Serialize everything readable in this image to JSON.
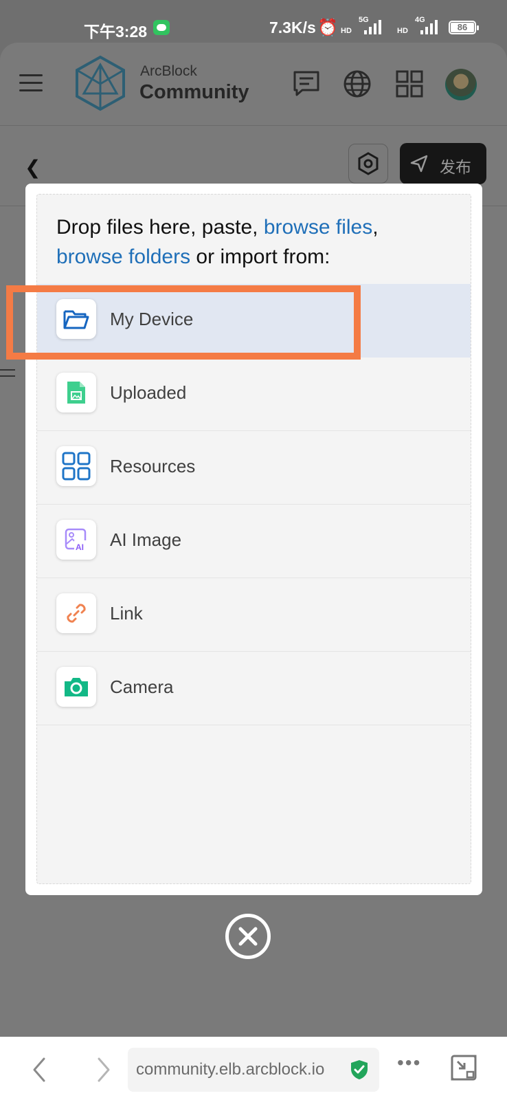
{
  "status_bar": {
    "time": "下午3:28",
    "net_speed": "7.3K/s",
    "sim1_label": "5G",
    "sim2_label": "4G",
    "hd_label": "HD",
    "battery": "86"
  },
  "header": {
    "brand_small": "ArcBlock",
    "brand_big": "Community"
  },
  "editor_bar": {
    "publish_label": "发布"
  },
  "upload_modal": {
    "prompt_text_1": "Drop files here, paste, ",
    "browse_files": "browse files",
    "prompt_comma": ",",
    "browse_folders": "browse folders",
    "prompt_text_2": " or import from:",
    "sources": [
      {
        "label": "My Device",
        "icon": "folder-open-icon",
        "color": "#1565c0"
      },
      {
        "label": "Uploaded",
        "icon": "image-file-icon",
        "color": "#3ecf8e"
      },
      {
        "label": "Resources",
        "icon": "grid-icon",
        "color": "#1e74c7"
      },
      {
        "label": "AI Image",
        "icon": "ai-image-icon",
        "color": "#8b5cf6"
      },
      {
        "label": "Link",
        "icon": "link-icon",
        "color": "#f08250"
      },
      {
        "label": "Camera",
        "icon": "camera-icon",
        "color": "#12b886"
      }
    ]
  },
  "browser": {
    "url": "community.elb.arcblock.io"
  }
}
